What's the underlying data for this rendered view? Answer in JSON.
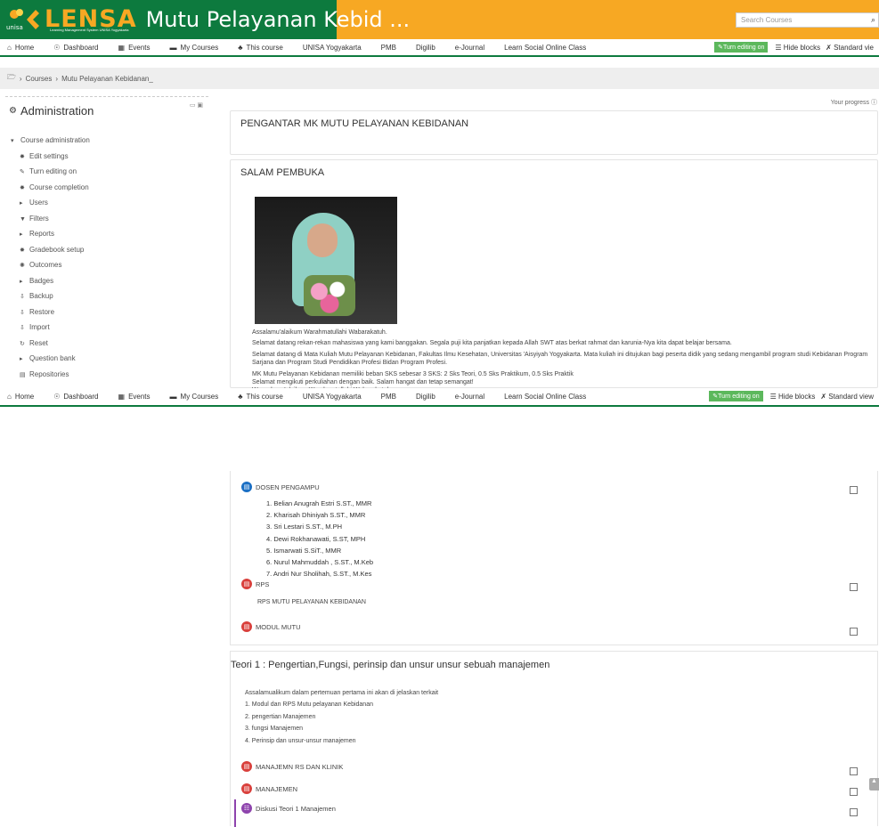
{
  "header": {
    "logo_text": "LENSA",
    "logo_small": "unisa",
    "logo_tagline": "Learning Management System UNISA Yogyakarta",
    "site_title": "Mutu Pelayanan Kebid ...",
    "search_placeholder": "Search Courses",
    "colors": {
      "brand_green": "#0d7a3e",
      "brand_orange": "#f7a823"
    }
  },
  "nav": {
    "items": [
      {
        "label": "Home",
        "icon": "home-icon",
        "glyph": "⌂"
      },
      {
        "label": "Dashboard",
        "icon": "dashboard-icon",
        "glyph": "☉"
      },
      {
        "label": "Events",
        "icon": "calendar-icon",
        "glyph": "▦"
      },
      {
        "label": "My Courses",
        "icon": "briefcase-icon",
        "glyph": "▬"
      },
      {
        "label": "This course",
        "icon": "sitemap-icon",
        "glyph": "♣"
      },
      {
        "label": "UNISA Yogyakarta",
        "icon": "",
        "glyph": ""
      },
      {
        "label": "PMB",
        "icon": "",
        "glyph": ""
      },
      {
        "label": "Digilib",
        "icon": "",
        "glyph": ""
      },
      {
        "label": "e-Journal",
        "icon": "",
        "glyph": ""
      },
      {
        "label": "Learn Social Online Class",
        "icon": "",
        "glyph": ""
      }
    ],
    "turn_editing_on": "Turn editing on",
    "hide_blocks": "Hide blocks",
    "standard_view_1": "Standard vie",
    "standard_view_2": "Standard view"
  },
  "breadcrumb": {
    "items": [
      "Courses",
      "Mutu Pelayanan Kebidanan_"
    ]
  },
  "sidebar": {
    "title": "Administration",
    "course_admin": "Course administration",
    "items": [
      {
        "label": "Edit settings",
        "glyph": "✸",
        "icon": "gear-icon"
      },
      {
        "label": "Turn editing on",
        "glyph": "✎",
        "icon": "pencil-icon"
      },
      {
        "label": "Course completion",
        "glyph": "✸",
        "icon": "gear-icon"
      },
      {
        "label": "Users",
        "glyph": "▸",
        "icon": "chevron-right-icon"
      },
      {
        "label": "Filters",
        "glyph": "▼",
        "icon": "filter-icon"
      },
      {
        "label": "Reports",
        "glyph": "▸",
        "icon": "chevron-right-icon"
      },
      {
        "label": "Gradebook setup",
        "glyph": "✸",
        "icon": "gear-icon"
      },
      {
        "label": "Outcomes",
        "glyph": "✺",
        "icon": "outcomes-icon"
      },
      {
        "label": "Badges",
        "glyph": "▸",
        "icon": "chevron-right-icon"
      },
      {
        "label": "Backup",
        "glyph": "⇩",
        "icon": "upload-icon"
      },
      {
        "label": "Restore",
        "glyph": "⇩",
        "icon": "upload-icon"
      },
      {
        "label": "Import",
        "glyph": "⇩",
        "icon": "upload-icon"
      },
      {
        "label": "Reset",
        "glyph": "↻",
        "icon": "refresh-icon"
      },
      {
        "label": "Question bank",
        "glyph": "▸",
        "icon": "chevron-right-icon"
      },
      {
        "label": "Repositories",
        "glyph": "▤",
        "icon": "database-icon"
      }
    ]
  },
  "progress_label": "Your progress",
  "sections": {
    "s1_title": "PENGANTAR MK MUTU PELAYANAN KEBIDANAN",
    "s2_title": "SALAM PEMBUKA",
    "s2_paragraphs": [
      "Assalamu'alaikum Warahmatullahi Wabarakatuh.",
      "Selamat datang rekan-rekan mahasiswa yang kami banggakan. Segala puji kita panjatkan kepada Allah SWT atas berkat rahmat dan karunia-Nya kita dapat belajar bersama.",
      "Selamat datang di Mata Kuliah Mutu Pelayanan Kebidanan, Fakultas Ilmu Kesehatan, Universitas 'Aisyiyah Yogyakarta. Mata kuliah ini ditujukan bagi peserta didik yang sedang mengambil program studi Kebidanan Program Sarjana dan Program Studi Pendidikan Profesi Bidan Program Profesi.",
      "MK Mutu Pelayanan Kebidanan memiliki beban SKS sebesar 3 SKS: 2 Sks Teori, 0.5 Sks Praktikum, 0.5 Sks Praktik\nSelamat mengikuti perkuliahan dengan baik. Salam hangat dan tetap semangat!\nWassalamu'alaikum Warahmatullahi Wabarakatuh."
    ],
    "dosen_label": "DOSEN PENGAMPU",
    "lecturers": [
      "1. Belian Anugrah Estri S.ST., MMR",
      "2. Kharisah Dhiniyah S.ST., MMR",
      "3. Sri Lestari  S.ST., M.PH",
      "4. Dewi Rokhanawati, S.ST, MPH",
      "5. Ismarwati S.SiT., MMR",
      "6. Nurul Mahmuddah , S.ST., M.Keb",
      "7. Andri Nur Sholihah, S.ST., M.Kes"
    ],
    "rps_label": "RPS",
    "rps_desc": "RPS MUTU PELAYANAN KEBIDANAN",
    "modul_label": "MODUL MUTU",
    "s4_title": "Teori 1 : Pengertian,Fungsi, perinsip dan unsur unsur sebuah manajemen",
    "s4_lines": [
      "Assalamualikum dalam pertemuan pertama ini akan di jelaskan terkait",
      "1. Modul dan RPS  Mutu pelayanan Kebidanan",
      "2. pengertian Manajemen",
      "3. fungsi Manajemen",
      "4. Perinsip dan unsur-unsur manajemen"
    ],
    "res1": "MANAJEMN RS DAN KLINIK",
    "res2": "MANAJEMEN",
    "forum": "Diskusi Teori 1 Manajemen"
  }
}
